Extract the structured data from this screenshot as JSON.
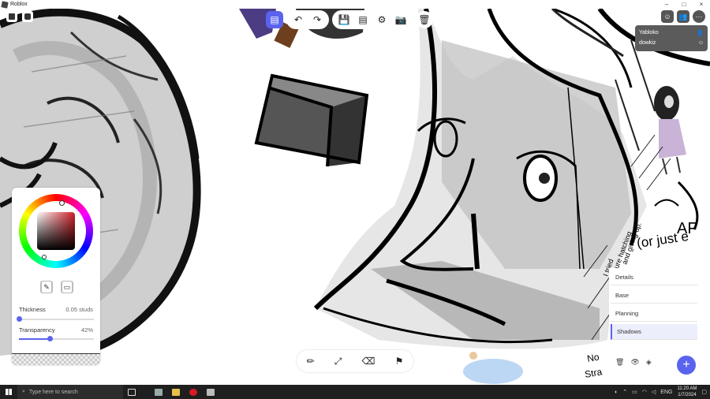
{
  "window": {
    "title": "Roblox",
    "controls": [
      "–",
      "□",
      "×"
    ]
  },
  "toolbar": {
    "undo": "↶",
    "redo": "↷",
    "save": "💾",
    "board": "▤",
    "settings": "⚙",
    "camera": "📷",
    "delete": "🗑"
  },
  "players": [
    {
      "name": "Yabloko",
      "icon": "person-icon"
    },
    {
      "name": "dowkiz",
      "icon": "smile-icon"
    }
  ],
  "color_picker": {
    "thickness_label": "Thickness",
    "thickness_value": "0.05 studs",
    "thickness": 0.0,
    "transparency_label": "Transparency",
    "transparency_value": "42%",
    "transparency": 0.42,
    "colors": {
      "selected": "#d0202a",
      "accent": "#5a63ee"
    }
  },
  "tools": [
    "pencil-icon",
    "line-icon",
    "eraser-icon",
    "flag-icon"
  ],
  "layers": {
    "items": [
      "Details",
      "Base",
      "Planning",
      "Shadows"
    ],
    "selected": "Shadows"
  },
  "canvas_text": {
    "a1": "AF",
    "a2": "(or just e",
    "side1": "I tried",
    "side2": "pure hatching",
    "side3": "and giving up.",
    "side4": "No",
    "side5": "Stra"
  },
  "taskbar": {
    "search_placeholder": "Type here to search",
    "lang": "ENG",
    "time": "11:20 AM",
    "date": "1/7/2024"
  }
}
